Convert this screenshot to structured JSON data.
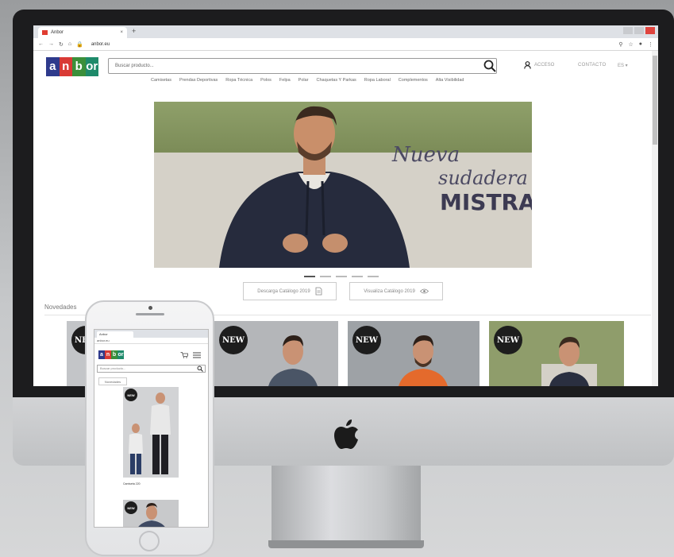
{
  "browser": {
    "tab_title": "Anbor",
    "tab_close": "×",
    "new_tab": "+",
    "url": "anbor.eu"
  },
  "header": {
    "logo_letters": [
      "a",
      "n",
      "b",
      "or"
    ],
    "search_placeholder": "Buscar producto...",
    "account_label": "ACCESO",
    "contact_label": "CONTACTO",
    "language": "ES ▾"
  },
  "nav": {
    "items": [
      "Camisetas",
      "Prendas Deportivas",
      "Ropa Técnica",
      "Polos",
      "Felpa",
      "Polar",
      "Chaquetas Y Parkas",
      "Ropa Laboral",
      "Complementos",
      "Alta Visibilidad"
    ]
  },
  "hero": {
    "line1": "Nueva",
    "line2": "sudadera",
    "line3": "MISTRAL",
    "slide_count": 5,
    "active_slide": 1
  },
  "actions": {
    "download_label": "Descarga Catálogo 2019",
    "view_label": "Visualiza Catálogo 2019"
  },
  "section": {
    "title": "Novedades",
    "badge": "NEW"
  },
  "mobile": {
    "tab_title": "Anbor",
    "url": "anbor.eu",
    "search_placeholder": "Buscar producto...",
    "tab_label": "Novedades",
    "badge": "NEW",
    "caption": "Camiseta 220"
  },
  "colors": {
    "logo_blue": "#2e3a8c",
    "logo_red": "#d93a35",
    "logo_green": "#3b8f3a",
    "logo_teal": "#1e8a6a"
  }
}
